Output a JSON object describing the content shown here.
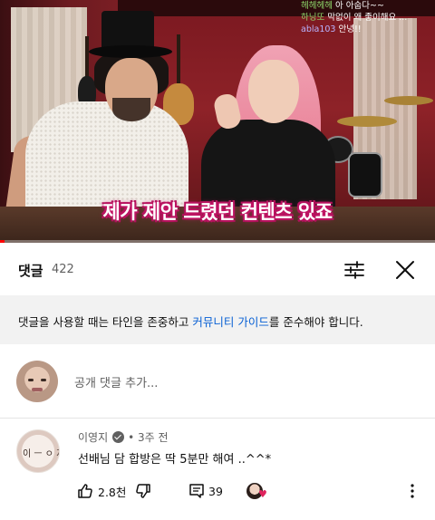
{
  "video": {
    "caption": "제가 제안 드렸던 컨텐츠 있죠",
    "live_chat": [
      {
        "user": "헤헤헤헤",
        "text": "아 아숩다~~"
      },
      {
        "user": "하닝또",
        "text": "막없이 왜 좋이해요 ..."
      },
      {
        "user": "abla103",
        "text": "안녕!!"
      }
    ],
    "progress_percent": 1
  },
  "comments_panel": {
    "title": "댓글",
    "count": "422",
    "sort_icon": "sliders-icon",
    "close_icon": "close-icon",
    "guideline": {
      "before": "댓글을 사용할 때는 타인을 존중하고 ",
      "link": "커뮤니티 가이드",
      "after": "를 준수해야 합니다."
    },
    "add_comment_placeholder": "공개 댓글 추가...",
    "comment": {
      "author": "이영지",
      "time": "3주 전",
      "text": "선배님 담 합방은 딱 5분만 해여 ..^^*",
      "likes": "2.8천",
      "replies": "39",
      "avatar_doodle": "이 ㅡ ㅇ 지"
    },
    "colors": {
      "link": "#065fd4",
      "secondary_text": "#606060",
      "guide_bg": "#f2f2f2",
      "heart": "#e0245e",
      "progress": "#ff0000"
    }
  }
}
